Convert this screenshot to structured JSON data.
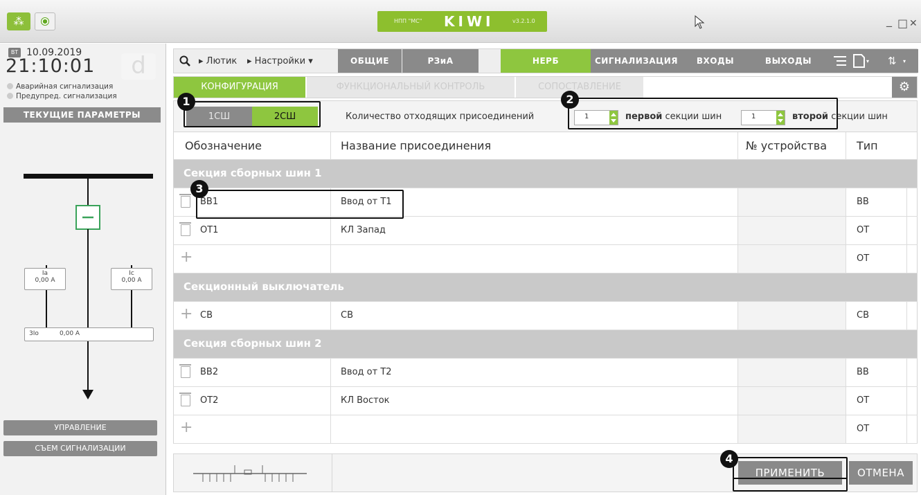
{
  "window": {
    "brand": "KIWI",
    "brand_left_small": "НПП \"МС\"",
    "brand_right_small": "v3.2.1.0",
    "minimize": "_",
    "maximize": "□",
    "close": "✕"
  },
  "status": {
    "day": "ВТ",
    "date": "10.09.2019",
    "time": "21:10:01",
    "d_badge": "d",
    "alarm_emergency": "Аварийная сигнализация",
    "alarm_warning": "Предупред. сигнализация",
    "current_params": "ТЕКУЩИЕ ПАРАМЕТРЫ"
  },
  "diagram": {
    "ia_label": "Ia",
    "ia_value": "0,00 A",
    "ic_label": "Ic",
    "ic_value": "0,00 A",
    "i0_label": "3Io",
    "i0_value": "0,00 A",
    "breaker_symbol": "−"
  },
  "side_buttons": {
    "control": "УПРАВЛЕНИЕ",
    "reset_alarm": "СЪЕМ СИГНАЛИЗАЦИИ"
  },
  "nav": {
    "crumb1": "Лютик",
    "crumb2": "Настройки",
    "tabs": [
      {
        "label": "ОБЩИЕ"
      },
      {
        "label": "РЗиА"
      },
      {
        "label": "НЕРБ"
      },
      {
        "label": "СИГНАЛИЗАЦИЯ"
      },
      {
        "label": "ВХОДЫ"
      },
      {
        "label": "ВЫХОДЫ"
      }
    ]
  },
  "subtabs": {
    "config": "КОНФИГУРАЦИЯ",
    "functional": "ФУНКЦИОНАЛЬНЫЙ КОНТРОЛЬ",
    "matching": "СОПОСТАВЛЕНИЕ"
  },
  "config": {
    "sec1": "1СШ",
    "sec2": "2СШ",
    "label": "Количество отходящих присоединений",
    "first_value": "1",
    "first_bold": "первой",
    "first_rest": "секции шин",
    "second_value": "1",
    "second_bold": "второй",
    "second_rest": "секции шин"
  },
  "table": {
    "headers": [
      "Обозначение",
      "Название присоединения",
      "№ устройства",
      "Тип"
    ],
    "section1": "Секция сборных шин 1",
    "section_cb": "Секционный выключатель",
    "section2": "Секция сборных шин 2",
    "rows_s1": [
      {
        "code": "ВВ1",
        "name": "Ввод от Т1",
        "type": "ВВ"
      },
      {
        "code": "ОТ1",
        "name": "КЛ Запад",
        "type": "ОТ"
      },
      {
        "code": "",
        "name": "",
        "type": "ОТ"
      }
    ],
    "rows_cb": [
      {
        "code": "СВ",
        "name": "СВ",
        "type": "СВ"
      }
    ],
    "rows_s2": [
      {
        "code": "ВВ2",
        "name": "Ввод от Т2",
        "type": "ВВ"
      },
      {
        "code": "ОТ2",
        "name": "КЛ Восток",
        "type": "ОТ"
      },
      {
        "code": "",
        "name": "",
        "type": "ОТ"
      }
    ]
  },
  "bottom": {
    "apply": "ПРИМЕНИТЬ",
    "cancel": "ОТМЕНА"
  },
  "callouts": [
    "1",
    "2",
    "3",
    "4"
  ],
  "colors": {
    "accent_green": "#8ec63f",
    "gray_button": "#8a8a8a"
  }
}
